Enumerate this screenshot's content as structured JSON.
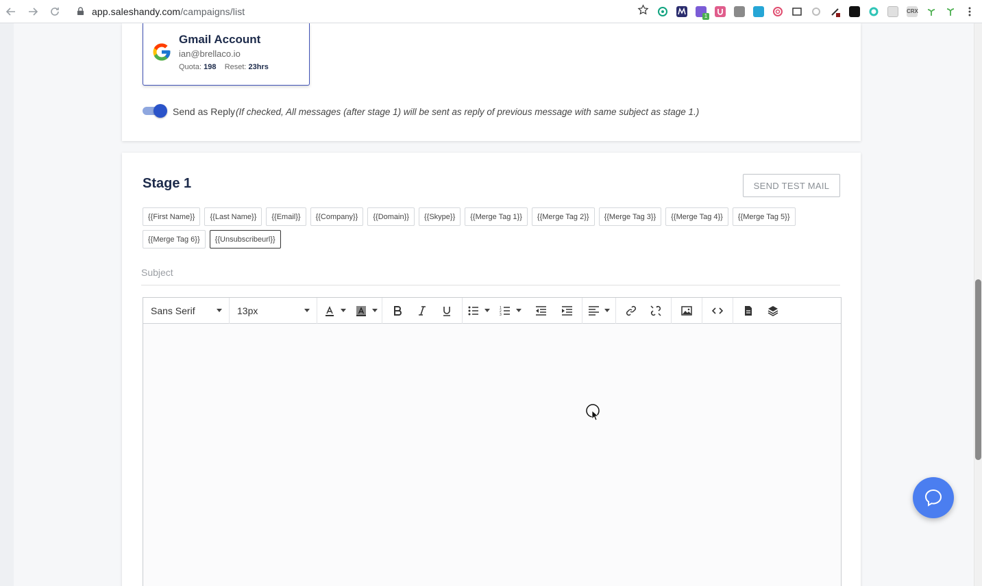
{
  "browser": {
    "url_host": "app.saleshandy.com",
    "url_path": "/campaigns/list",
    "extensions": [
      {
        "name": "openai-icon",
        "color": "#10a37f"
      },
      {
        "name": "m-icon",
        "color": "#2b2d6e"
      },
      {
        "name": "puzzle-icon",
        "color": "#7b5cd6",
        "badge": "1"
      },
      {
        "name": "u-icon",
        "color": "#e05d8c"
      },
      {
        "name": "box-icon",
        "color": "#8a8a8a"
      },
      {
        "name": "cube-icon",
        "color": "#26a6d6"
      },
      {
        "name": "spiral-icon",
        "color": "#e04b6e"
      },
      {
        "name": "capture-icon",
        "color": "#333333"
      },
      {
        "name": "toggle-icon",
        "color": "#bdbdbd"
      },
      {
        "name": "pen-icon",
        "color": "#333333"
      },
      {
        "name": "layers-icon",
        "color": "#111111"
      },
      {
        "name": "ring-icon",
        "color": "#2ec4b6"
      },
      {
        "name": "grid-icon",
        "color": "#bdbdbd"
      },
      {
        "name": "crx-icon",
        "color": "#777777"
      },
      {
        "name": "sprout-icon",
        "color": "#4caf50"
      },
      {
        "name": "sprout2-icon",
        "color": "#4caf50"
      }
    ],
    "crx_label": "CRX"
  },
  "account": {
    "title": "Gmail Account",
    "email": "ian@brellaco.io",
    "quota_label": "Quota:",
    "quota_value": "198",
    "reset_label": "Reset:",
    "reset_value": "23hrs"
  },
  "reply": {
    "label": "Send as Reply",
    "note": "(If checked, All messages (after stage 1) will be sent as reply of previous message with same subject as stage 1.)",
    "enabled": true
  },
  "stage": {
    "title": "Stage 1",
    "test_button": "SEND TEST MAIL",
    "tags": [
      "{{First Name}}",
      "{{Last Name}}",
      "{{Email}}",
      "{{Company}}",
      "{{Domain}}",
      "{{Skype}}",
      "{{Merge Tag 1}}",
      "{{Merge Tag 2}}",
      "{{Merge Tag 3}}",
      "{{Merge Tag 4}}",
      "{{Merge Tag 5}}",
      "{{Merge Tag 6}}",
      "{{Unsubscribeurl}}"
    ],
    "active_tag": "{{Unsubscribeurl}}",
    "subject_placeholder": "Subject"
  },
  "editor": {
    "font_family": "Sans Serif",
    "font_size": "13px",
    "body": ""
  },
  "colors": {
    "accent": "#2a53c9",
    "fab": "#4b7ef0",
    "title": "#1c2a4a"
  }
}
